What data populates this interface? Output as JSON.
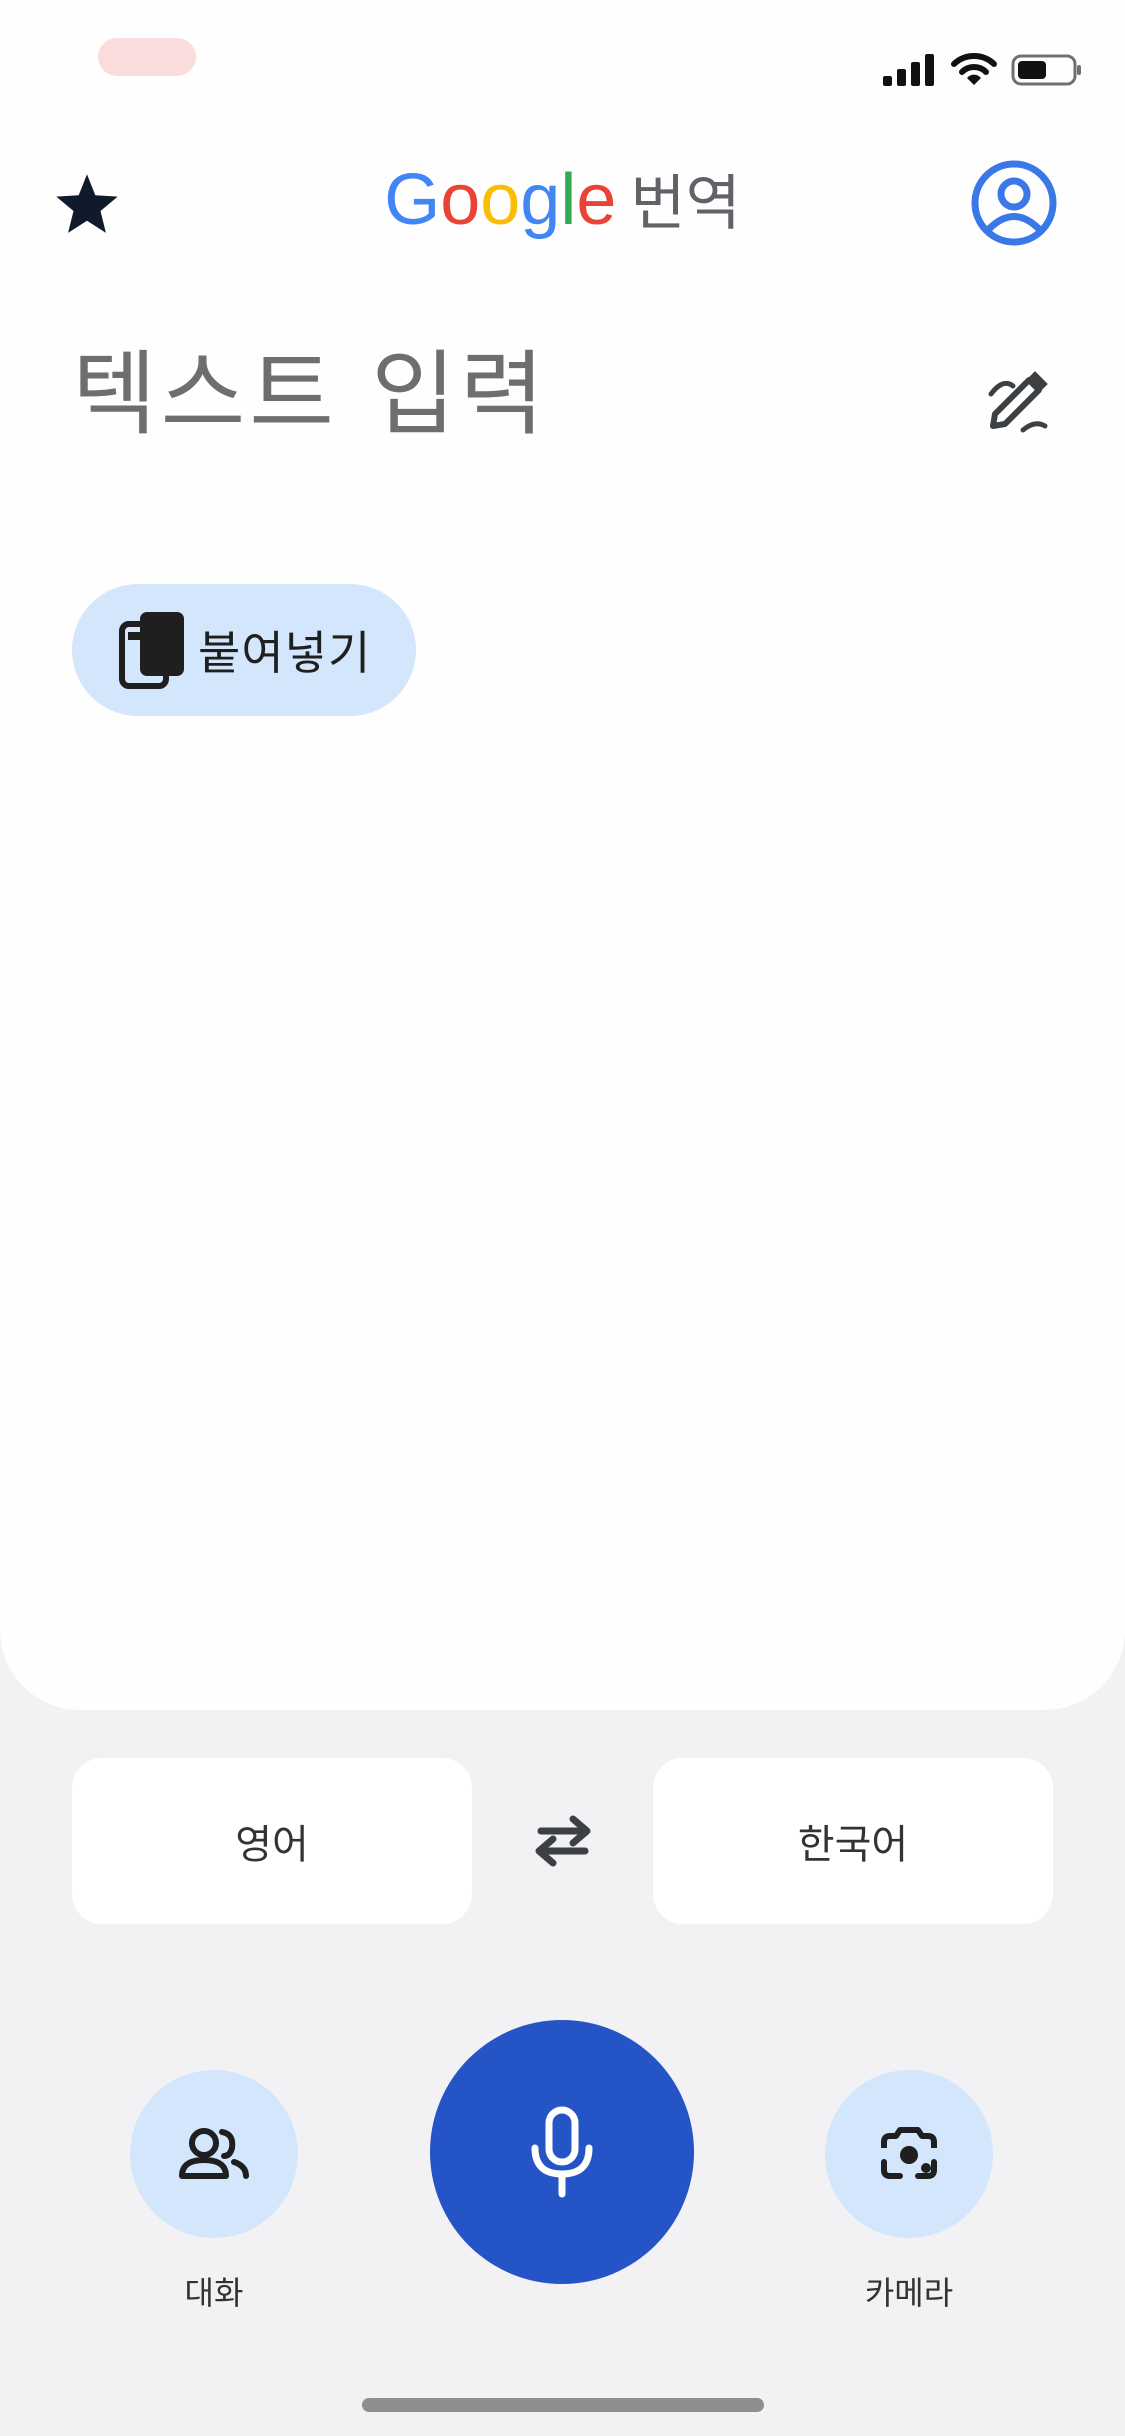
{
  "status_bar": {
    "icons": [
      "signal-icon",
      "wifi-icon",
      "battery-icon"
    ]
  },
  "header": {
    "brand": [
      "G",
      "o",
      "o",
      "g",
      "l",
      "e"
    ],
    "brand_colors": [
      "#4285F4",
      "#EA4335",
      "#FBBC05",
      "#4285F4",
      "#34A853",
      "#EA4335"
    ],
    "title": "번역",
    "icons": [
      "star-icon",
      "account-icon"
    ]
  },
  "input": {
    "placeholder": "텍스트 입력",
    "handwrite_icon": "handwriting-icon",
    "paste_label": "붙여넣기",
    "paste_icon": "clipboard-icon"
  },
  "languages": {
    "source": "영어",
    "target": "한국어",
    "swap_icon": "swap-arrows-icon"
  },
  "actions": {
    "conversation_label": "대화",
    "camera_label": "카메라",
    "mic_icon": "microphone-icon"
  },
  "colors": {
    "accent": "#2554c7",
    "chip_bg": "#d3e6fb",
    "account": "#3b78e7"
  }
}
